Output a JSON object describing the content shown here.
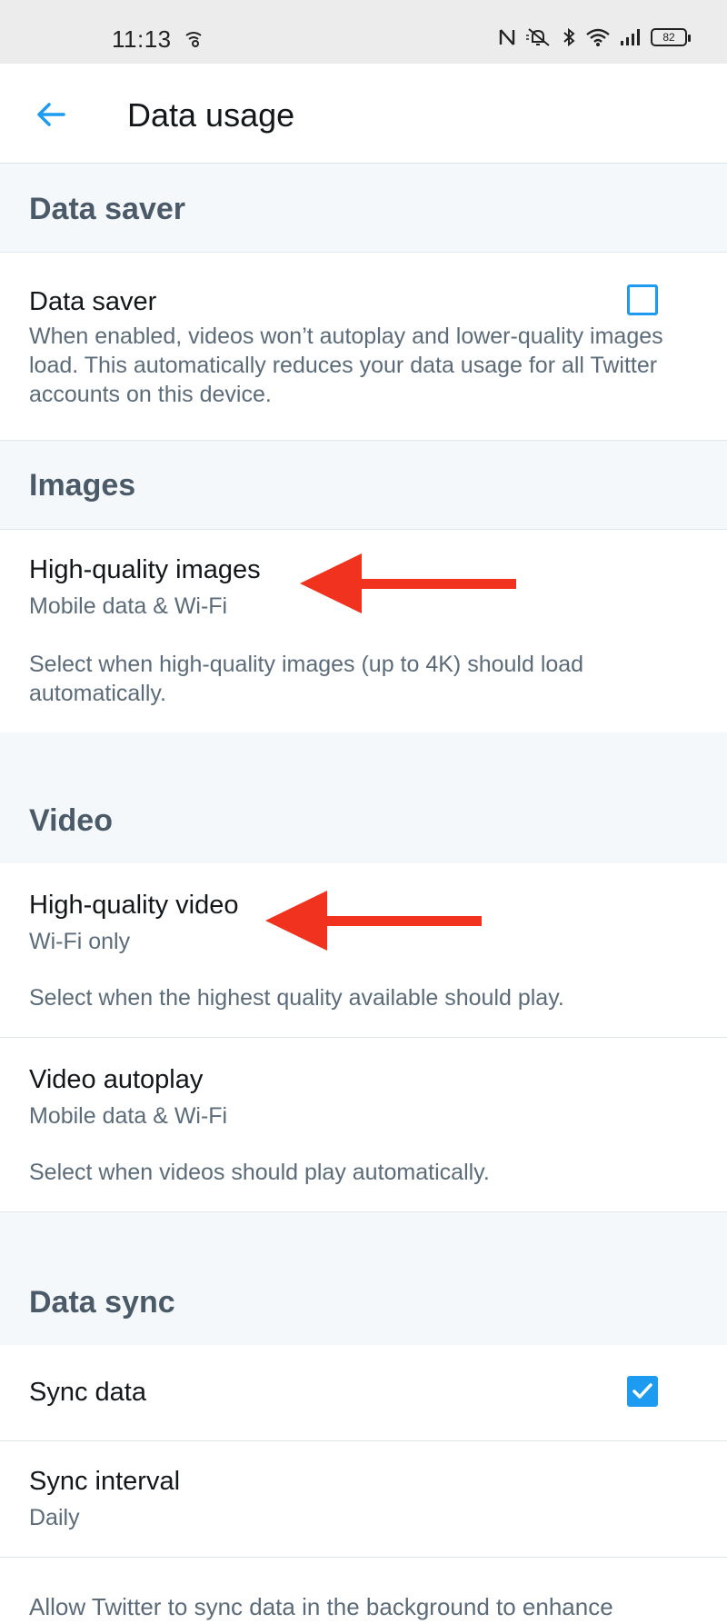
{
  "status": {
    "time": "11:13",
    "battery": "82"
  },
  "header": {
    "title": "Data usage"
  },
  "sections": {
    "data_saver": {
      "header": "Data saver",
      "title": "Data saver",
      "description": "When enabled, videos won’t autoplay and lower-quality images load. This automatically reduces your data usage for all Twitter accounts on this device.",
      "checked": false
    },
    "images": {
      "header": "Images",
      "hq_title": "High-quality images",
      "hq_value": "Mobile data & Wi-Fi",
      "hq_description": "Select when high-quality images (up to 4K) should load automatically."
    },
    "video": {
      "header": "Video",
      "hq_title": "High-quality video",
      "hq_value": "Wi-Fi only",
      "hq_description": "Select when the highest quality available should play.",
      "autoplay_title": "Video autoplay",
      "autoplay_value": "Mobile data & Wi-Fi",
      "autoplay_description": "Select when videos should play automatically."
    },
    "data_sync": {
      "header": "Data sync",
      "sync_title": "Sync data",
      "sync_checked": true,
      "interval_title": "Sync interval",
      "interval_value": "Daily",
      "description": "Allow Twitter to sync data in the background to enhance"
    }
  },
  "colors": {
    "accent": "#1d9bf0",
    "annotation_arrow": "#f0321e"
  },
  "icons": [
    "nfc-icon",
    "mute-icon",
    "bluetooth-icon",
    "wifi-icon",
    "signal-icon",
    "battery-icon",
    "back-arrow-icon",
    "hotspot-icon"
  ]
}
